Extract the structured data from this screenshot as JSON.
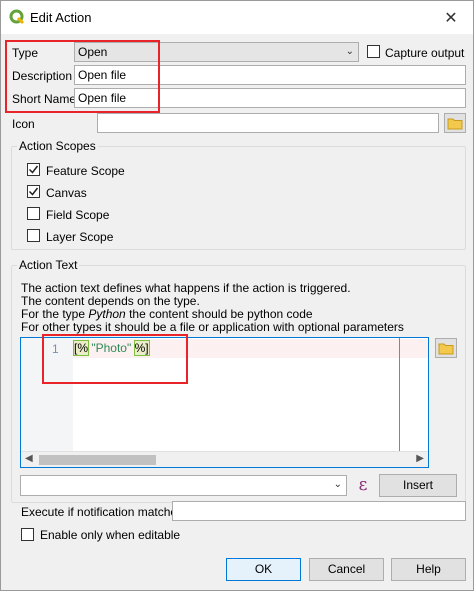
{
  "window": {
    "title": "Edit Action",
    "close_glyph": "✕"
  },
  "form": {
    "type_label": "Type",
    "type_value": "Open",
    "capture_output_label": "Capture output",
    "description_label": "Description",
    "description_value": "Open file",
    "short_name_label": "Short Name",
    "short_name_value": "Open file",
    "icon_label": "Icon",
    "icon_value": ""
  },
  "action_scopes": {
    "title": "Action Scopes",
    "items": [
      {
        "label": "Feature Scope",
        "checked": true
      },
      {
        "label": "Canvas",
        "checked": true
      },
      {
        "label": "Field Scope",
        "checked": false
      },
      {
        "label": "Layer Scope",
        "checked": false
      }
    ]
  },
  "action_text": {
    "title": "Action Text",
    "help_line_1": "The action text defines what happens if the action is triggered.",
    "help_line_2": "The content depends on the type.",
    "help_line_3_pre": "For the type ",
    "help_line_3_em": "Python",
    "help_line_3_post": " the content should be python code",
    "help_line_4": "For other types it should be a file or application with optional parameters",
    "line_number": "1",
    "code_open": "[%",
    "code_string": " \"Photo\" ",
    "code_close": "%]",
    "expression_value": "",
    "insert_button": "Insert"
  },
  "notification": {
    "label": "Execute if notification matches",
    "value": ""
  },
  "editable": {
    "label": "Enable only when editable",
    "checked": false
  },
  "buttons": {
    "ok": "OK",
    "cancel": "Cancel",
    "help": "Help"
  },
  "colors": {
    "annotation_red": "#e8232a",
    "qgis_green": "#62a23a",
    "folder_yellow": "#f2c94c"
  }
}
